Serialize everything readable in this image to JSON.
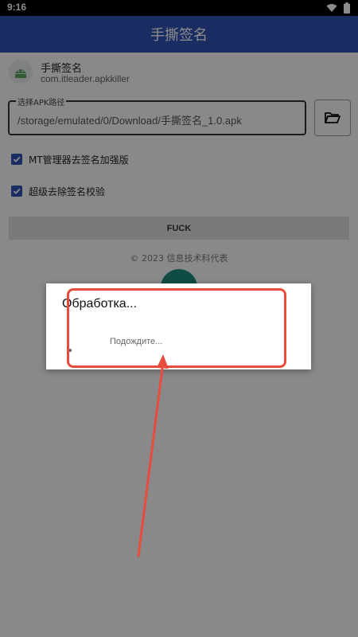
{
  "status_bar": {
    "time": "9:16",
    "icons": [
      "wifi-icon",
      "battery-icon"
    ]
  },
  "app_bar": {
    "title": "手撕签名"
  },
  "app_info": {
    "name": "手撕签名",
    "package": "com.itleader.apkkiller",
    "icon": "android-app-icon"
  },
  "apk_path": {
    "label": "选择APK路径",
    "value": "/storage/emulated/0/Download/手撕签名_1.0.apk"
  },
  "folder_button": {
    "icon": "folder-open-icon"
  },
  "options": [
    {
      "label": "MT管理器去签名加强版",
      "checked": true
    },
    {
      "label": "超级去除签名校验",
      "checked": true
    }
  ],
  "action_button": {
    "label": "FUCK"
  },
  "footer": {
    "copyright": "© 2023 信息技术科代表"
  },
  "dialog": {
    "title": "Обработка...",
    "message": "Подождите..."
  },
  "colors": {
    "primary": "#2f53b3",
    "fab": "#1d8a7c",
    "annotation": "#e84c3d"
  }
}
